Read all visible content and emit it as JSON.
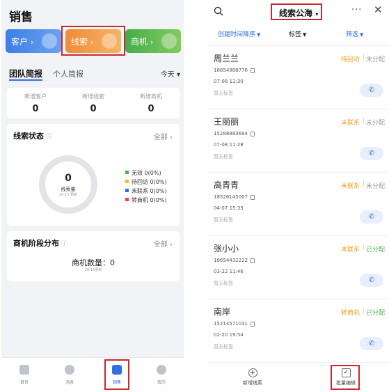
{
  "left": {
    "title": "销售",
    "cards": [
      {
        "label": "客户",
        "arrow": "›"
      },
      {
        "label": "线索",
        "arrow": "›"
      },
      {
        "label": "商机",
        "arrow": "›"
      }
    ],
    "tabs": {
      "team": "团队简报",
      "personal": "个人简报",
      "period": "今天"
    },
    "stats": [
      {
        "label": "新增客户",
        "value": "0"
      },
      {
        "label": "新增线索",
        "value": "0"
      },
      {
        "label": "新增商机",
        "value": "0"
      }
    ],
    "lead_status": {
      "title": "线索状态",
      "all": "全部 ›",
      "total_value": "0",
      "total_label": "线索量",
      "updated": "20:15 更新",
      "legend": [
        {
          "label": "无效",
          "value": "0(0%)",
          "color": "#4caf50"
        },
        {
          "label": "待回访",
          "value": "0(0%)",
          "color": "#f5b623"
        },
        {
          "label": "未联系",
          "value": "0(0%)",
          "color": "#2f6fe0"
        },
        {
          "label": "转商机",
          "value": "0(0%)",
          "color": "#e5483e"
        }
      ]
    },
    "stage": {
      "title": "商机阶段分布",
      "all": "全部 ›",
      "count_text": "商机数量：0",
      "updated": "20:15更新"
    },
    "nav": [
      {
        "label": "首页"
      },
      {
        "label": "消息"
      },
      {
        "label": "销售"
      },
      {
        "label": "我的"
      }
    ]
  },
  "right": {
    "title": "线索公海",
    "filters": [
      {
        "label": "创建时间降序",
        "color": "#2f6fe0"
      },
      {
        "label": "标签",
        "color": "#222222"
      },
      {
        "label": "筛选",
        "color": "#2f6fe0"
      }
    ],
    "leads": [
      {
        "name": "周兰兰",
        "status": "待回访",
        "status_color": "#f0a020",
        "assign": "未分配",
        "assign_color": "#999999",
        "phone": "18854988776",
        "time": "07-08 11:30",
        "tag": "暂无标签"
      },
      {
        "name": "王丽丽",
        "status": "未联系",
        "status_color": "#f0a020",
        "assign": "未分配",
        "assign_color": "#999999",
        "phone": "15288883694",
        "time": "07-08 11:28",
        "tag": "暂无标签"
      },
      {
        "name": "高青青",
        "status": "未联系",
        "status_color": "#f0a020",
        "assign": "未分配",
        "assign_color": "#999999",
        "phone": "18526145007",
        "time": "04-07 15:33",
        "tag": "暂无标签"
      },
      {
        "name": "张小小",
        "status": "未联系",
        "status_color": "#f0a020",
        "assign": "已分配",
        "assign_color": "#4caf50",
        "phone": "18654432222",
        "time": "03-22 11:46",
        "tag": "暂无标签"
      },
      {
        "name": "南岸",
        "status": "转商机",
        "status_color": "#f0a020",
        "assign": "已分配",
        "assign_color": "#4caf50",
        "phone": "15214571031",
        "time": "02-20 19:54",
        "tag": "暂无标签"
      }
    ],
    "bottom": [
      {
        "label": "新增线索"
      },
      {
        "label": "批量编辑"
      }
    ]
  }
}
